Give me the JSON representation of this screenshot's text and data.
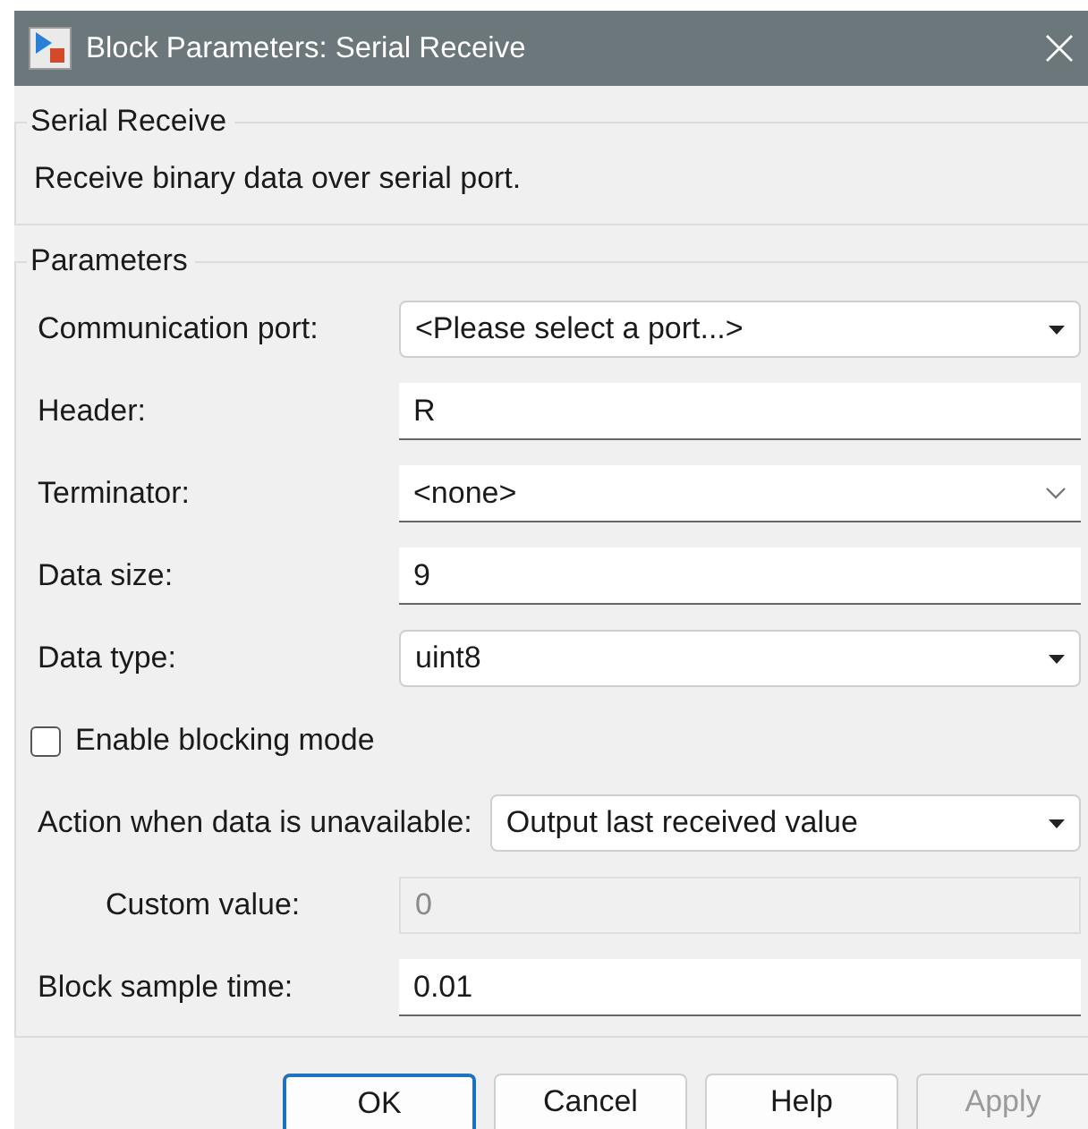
{
  "window": {
    "title": "Block Parameters: Serial Receive"
  },
  "description_group": {
    "title": "Serial Receive",
    "text": "Receive binary data over serial port."
  },
  "parameters": {
    "title": "Parameters",
    "rows": [
      {
        "kind": "dropdown",
        "label": "Communication port:",
        "value": "<Please select a port...>"
      },
      {
        "kind": "text",
        "label": "Header:",
        "value": "R",
        "disabled": false
      },
      {
        "kind": "combo",
        "label": "Terminator:",
        "value": "<none>"
      },
      {
        "kind": "text",
        "label": "Data size:",
        "value": "9",
        "disabled": false
      },
      {
        "kind": "dropdown",
        "label": "Data type:",
        "value": "uint8"
      },
      {
        "kind": "checkbox",
        "label": "Enable blocking mode",
        "checked": false
      },
      {
        "kind": "dropdown",
        "label": "Action when data is unavailable:",
        "value": "Output last received value",
        "children": [
          {
            "kind": "text",
            "label": "Custom value:",
            "value": "0",
            "disabled": true
          }
        ]
      },
      {
        "kind": "text",
        "label": "Block sample time:",
        "value": "0.01",
        "disabled": false
      }
    ]
  },
  "buttons": [
    {
      "label": "OK",
      "default": true,
      "disabled": false
    },
    {
      "label": "Cancel",
      "default": false,
      "disabled": false
    },
    {
      "label": "Help",
      "default": false,
      "disabled": false
    },
    {
      "label": "Apply",
      "default": false,
      "disabled": true
    }
  ]
}
